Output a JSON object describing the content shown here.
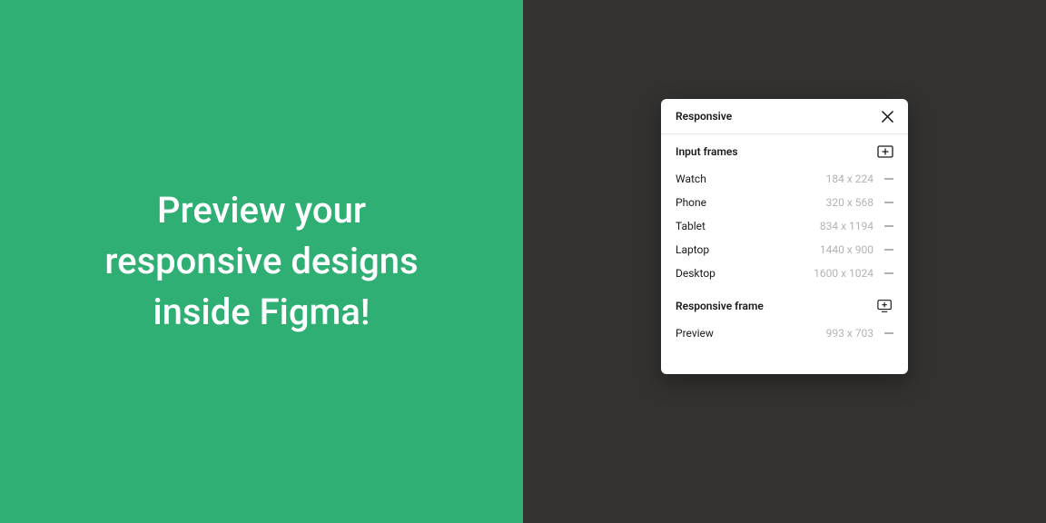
{
  "hero": {
    "headline": "Preview your responsive designs inside Figma!"
  },
  "panel": {
    "title": "Responsive",
    "sections": {
      "input": {
        "title": "Input frames",
        "frames": [
          {
            "name": "Watch",
            "dims": "184 x 224"
          },
          {
            "name": "Phone",
            "dims": "320 x 568"
          },
          {
            "name": "Tablet",
            "dims": "834 x 1194"
          },
          {
            "name": "Laptop",
            "dims": "1440 x 900"
          },
          {
            "name": "Desktop",
            "dims": "1600 x 1024"
          }
        ]
      },
      "responsive": {
        "title": "Responsive frame",
        "frames": [
          {
            "name": "Preview",
            "dims": "993 x 703"
          }
        ]
      }
    }
  },
  "colors": {
    "brand_green": "#2FAF74",
    "dark_bg": "#333230"
  }
}
